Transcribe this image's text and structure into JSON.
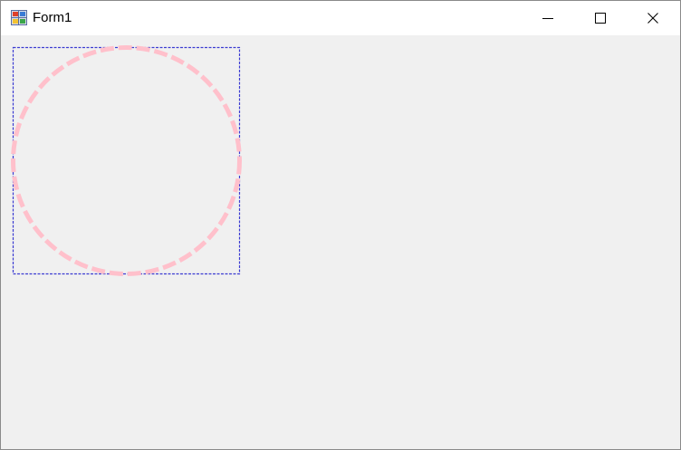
{
  "window": {
    "title": "Form1"
  },
  "icons": {
    "app": "form-app-icon",
    "minimize": "minimize-icon",
    "maximize": "maximize-icon",
    "close": "close-icon"
  },
  "colors": {
    "client_background": "#f0f0f0",
    "titlebar_background": "#ffffff",
    "bounding_rect": "#3c3cd2",
    "circle": "#ffc0cb"
  }
}
